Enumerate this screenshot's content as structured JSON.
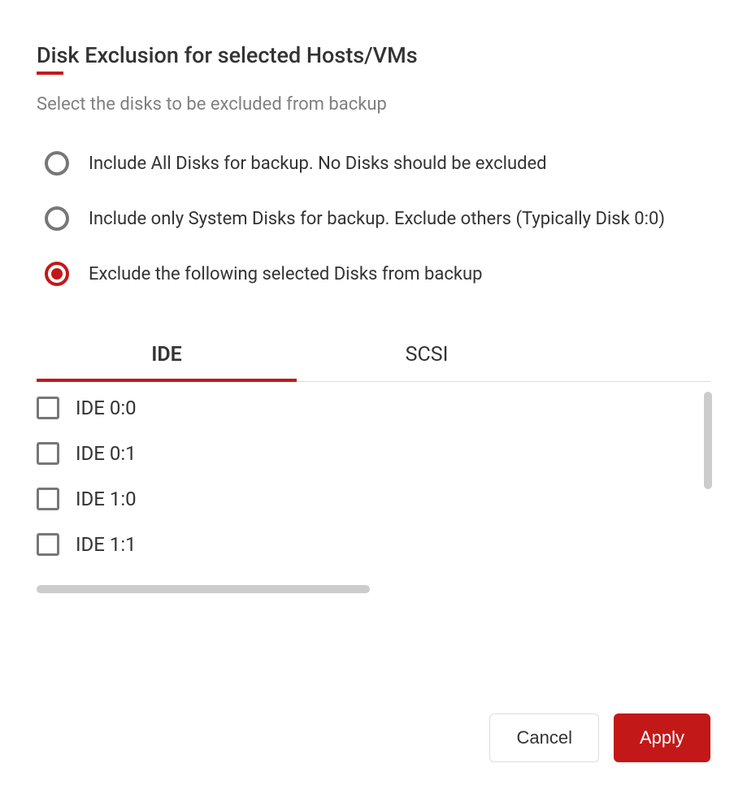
{
  "title": "Disk Exclusion for selected Hosts/VMs",
  "subtitle": "Select the disks to be excluded from backup",
  "radioOptions": [
    {
      "label": "Include All Disks for backup. No Disks should be excluded",
      "selected": false
    },
    {
      "label": "Include only System Disks for backup. Exclude others (Typically Disk 0:0)",
      "selected": false
    },
    {
      "label": "Exclude the following selected Disks from backup",
      "selected": true
    }
  ],
  "tabs": [
    {
      "label": "IDE",
      "active": true
    },
    {
      "label": "SCSI",
      "active": false
    }
  ],
  "disks": [
    {
      "label": "IDE 0:0",
      "checked": false
    },
    {
      "label": "IDE 0:1",
      "checked": false
    },
    {
      "label": "IDE 1:0",
      "checked": false
    },
    {
      "label": "IDE 1:1",
      "checked": false
    }
  ],
  "buttons": {
    "cancel": "Cancel",
    "apply": "Apply"
  },
  "colors": {
    "accent": "#c31818"
  }
}
